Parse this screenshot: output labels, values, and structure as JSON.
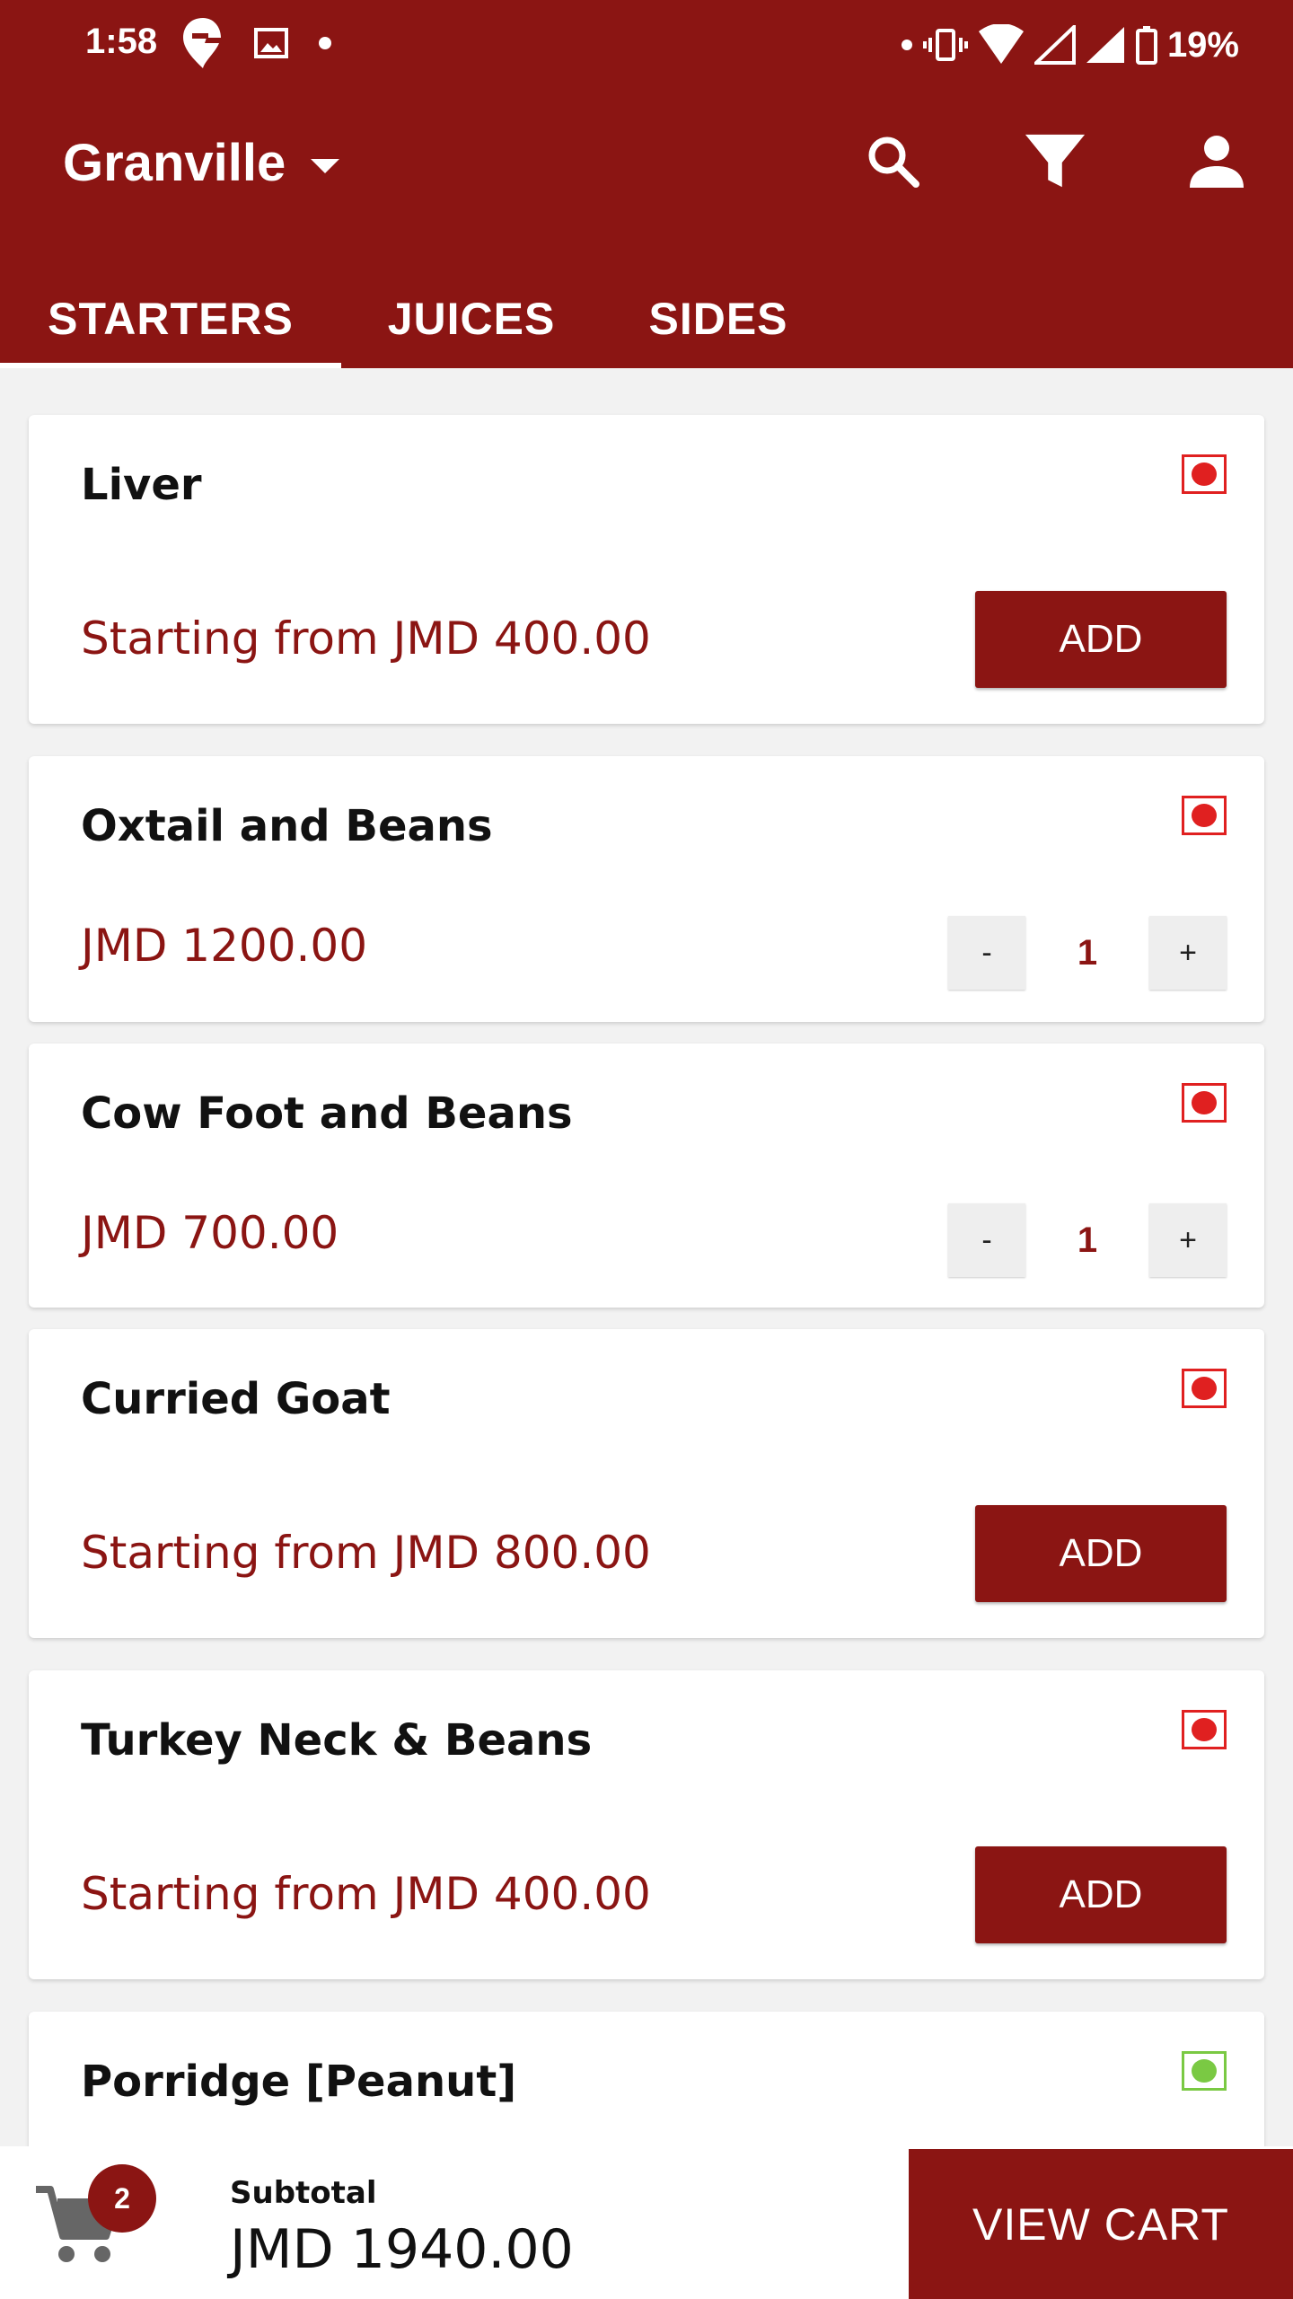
{
  "status_bar": {
    "time": "1:58",
    "battery": "19%",
    "left_icons": [
      "swiggy-icon",
      "image-icon",
      "dot-icon"
    ],
    "right_icons": [
      "vibrate-icon",
      "wifi-icon",
      "signal-icon",
      "signal-icon",
      "battery-icon"
    ]
  },
  "header": {
    "location": "Granville",
    "icons": [
      "search-icon",
      "filter-icon",
      "account-icon"
    ]
  },
  "tabs": [
    {
      "label": "STARTERS",
      "active": true
    },
    {
      "label": "JUICES",
      "active": false
    },
    {
      "label": "SIDES",
      "active": false
    }
  ],
  "items": [
    {
      "name": "Liver",
      "price": "Starting from JMD 400.00",
      "diet": "non-veg",
      "action": "ADD"
    },
    {
      "name": "Oxtail and Beans",
      "price": "JMD 1200.00",
      "diet": "non-veg",
      "qty": "1",
      "minus": "-",
      "plus": "+"
    },
    {
      "name": "Cow Foot and Beans",
      "price": "JMD 700.00",
      "diet": "non-veg",
      "qty": "1",
      "minus": "-",
      "plus": "+"
    },
    {
      "name": "Curried Goat",
      "price": "Starting from JMD 800.00",
      "diet": "non-veg",
      "action": "ADD"
    },
    {
      "name": "Turkey Neck & Beans",
      "price": "Starting from JMD 400.00",
      "diet": "non-veg",
      "action": "ADD"
    },
    {
      "name": "Porridge [Peanut]",
      "diet": "veg"
    }
  ],
  "cart": {
    "count": "2",
    "subtotal_label": "Subtotal",
    "subtotal_value": "JMD 1940.00",
    "view_cart_label": "VIEW CART"
  },
  "colors": {
    "primary": "#8b1513",
    "non_veg": "#e02020",
    "veg": "#7ac943"
  }
}
